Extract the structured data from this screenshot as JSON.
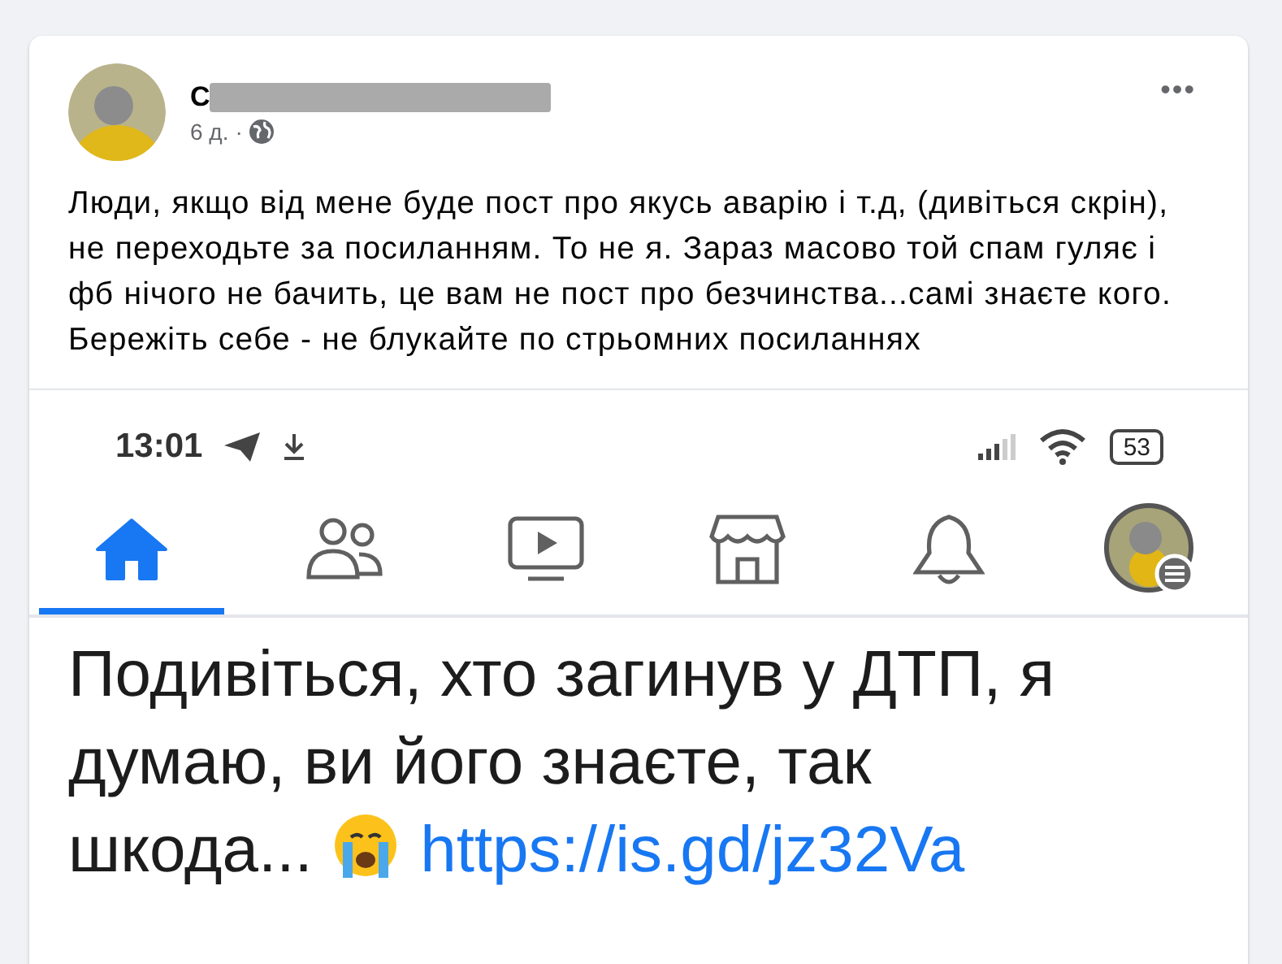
{
  "post": {
    "author": "С",
    "time": "6 д.",
    "separator": "·",
    "menu": "•••",
    "text": "Люди, якщо від мене буде пост про якусь аварію і т.д, (дивіться скрін), не переходьте за посиланням. То не я. Зараз масово той спам гуляє і фб нічого не бачить, це вам не пост про безчинства...самі знаєте кого. Бережіть себе - не блукайте по стрьомних посиланнях"
  },
  "screenshot": {
    "status_bar": {
      "time": "13:01",
      "battery": "53"
    },
    "nav": [
      {
        "kind": "home",
        "selected": true
      },
      {
        "kind": "friends",
        "selected": false
      },
      {
        "kind": "video",
        "selected": false
      },
      {
        "kind": "marketplace",
        "selected": false
      },
      {
        "kind": "notifications",
        "selected": false
      },
      {
        "kind": "profile",
        "selected": false
      }
    ],
    "message": {
      "text": "Подивіться, хто загинув у ДТП, я думаю, ви його знаєте, так шкода...",
      "link": "https://is.gd/jz32Va"
    }
  }
}
